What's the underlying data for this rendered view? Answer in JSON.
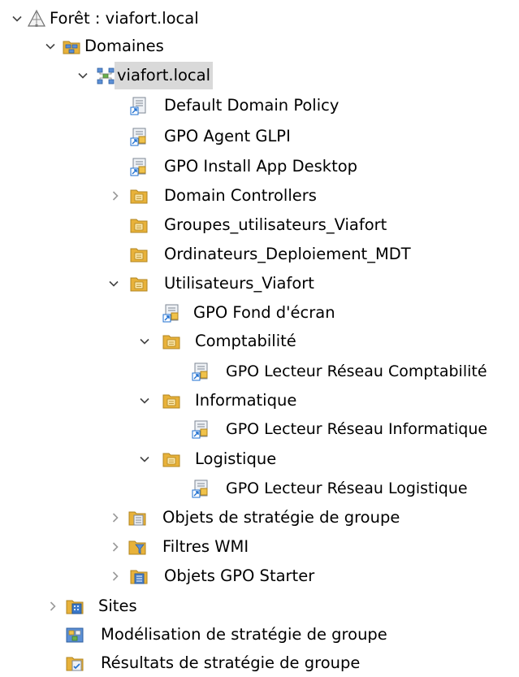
{
  "tree": {
    "forest": {
      "label": "Forêt : viafort.local",
      "expanded": true,
      "icon": "forest-icon"
    },
    "domaines": {
      "label": "Domaines",
      "expanded": true,
      "icon": "domains-icon"
    },
    "domain": {
      "label": "viafort.local",
      "expanded": true,
      "selected": true,
      "icon": "domain-icon"
    },
    "default_policy": {
      "label": "Default Domain Policy",
      "icon": "gpo-link-icon"
    },
    "gpo_agent": {
      "label": "GPO Agent GLPI",
      "icon": "gpo-link-icon"
    },
    "gpo_install": {
      "label": "GPO Install App Desktop",
      "icon": "gpo-link-icon"
    },
    "domain_controllers": {
      "label": "Domain Controllers",
      "expanded": false,
      "icon": "ou-folder-icon"
    },
    "groupes": {
      "label": "Groupes_utilisateurs_Viafort",
      "icon": "ou-folder-icon"
    },
    "ordinateurs": {
      "label": "Ordinateurs_Deploiement_MDT",
      "icon": "ou-folder-icon"
    },
    "utilisateurs": {
      "label": "Utilisateurs_Viafort",
      "expanded": true,
      "icon": "ou-folder-icon"
    },
    "gpo_fond": {
      "label": "GPO Fond d'écran",
      "icon": "gpo-link-icon"
    },
    "comptabilite": {
      "label": "Comptabilité",
      "expanded": true,
      "icon": "ou-folder-icon"
    },
    "gpo_compta": {
      "label": "GPO Lecteur Réseau Comptabilité",
      "icon": "gpo-link-icon"
    },
    "informatique": {
      "label": "Informatique",
      "expanded": true,
      "icon": "ou-folder-icon"
    },
    "gpo_info": {
      "label": "GPO Lecteur Réseau Informatique",
      "icon": "gpo-link-icon"
    },
    "logistique": {
      "label": "Logistique",
      "expanded": true,
      "icon": "ou-folder-icon"
    },
    "gpo_logi": {
      "label": "GPO Lecteur Réseau Logistique",
      "icon": "gpo-link-icon"
    },
    "objets_strategie": {
      "label": "Objets de stratégie de groupe",
      "expanded": false,
      "icon": "gpo-container-icon"
    },
    "filtres_wmi": {
      "label": "Filtres WMI",
      "expanded": false,
      "icon": "wmi-filter-icon"
    },
    "objets_starter": {
      "label": "Objets GPO Starter",
      "expanded": false,
      "icon": "starter-gpo-icon"
    },
    "sites": {
      "label": "Sites",
      "expanded": false,
      "icon": "sites-icon"
    },
    "modelisation": {
      "label": "Modélisation de stratégie de groupe",
      "icon": "modeling-icon"
    },
    "resultats": {
      "label": "Résultats de stratégie de groupe",
      "icon": "results-icon"
    }
  },
  "colors": {
    "selection": "#d9d9d9",
    "chevron": "#444444",
    "folder": "#e8b23a",
    "gpo_scroll": "#cfd6df",
    "link_arrow": "#1e6fd0"
  }
}
